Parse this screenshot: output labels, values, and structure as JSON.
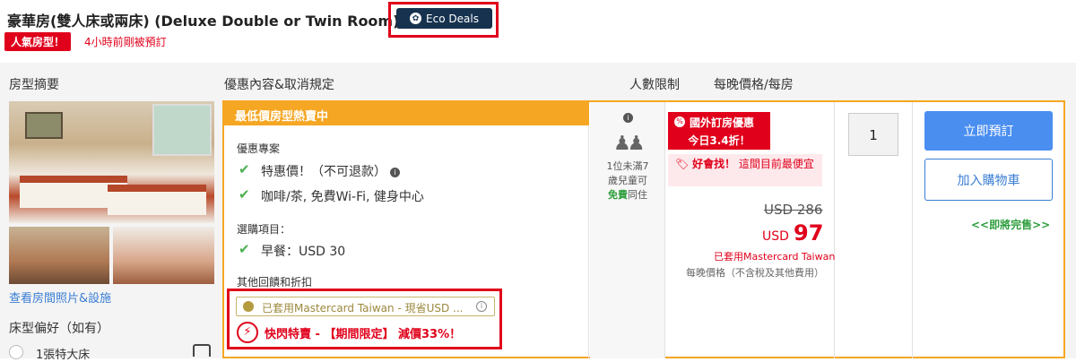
{
  "room": {
    "title": "豪華房(雙人床或兩床) (Deluxe Double or Twin Room)",
    "eco_label": "Eco Deals",
    "popular_label": "人氣房型！",
    "booked_text": "4小時前剛被預訂"
  },
  "columns": {
    "summary": "房型摘要",
    "deal": "優惠內容&取消規定",
    "people": "人數限制",
    "price": "每晚價格/每房"
  },
  "left": {
    "view_photos": "查看房間照片&設施",
    "bed_pref": "床型偏好（如有）",
    "bed_option": "1張特大床"
  },
  "deal": {
    "banner": "最低價房型熱賣中",
    "plan_title": "優惠專案",
    "item1": "特惠價！（不可退款）",
    "item2": "咖啡/茶, 免費Wi-Fi, 健身中心",
    "options_title": "選購項目：",
    "item3": "早餐：USD 30",
    "other_title": "其他回饋和折扣",
    "mc_text": "已套用Mastercard Taiwan - 現省USD ...",
    "flash_text": "快閃特賣 - 【期間限定】 減價33%！"
  },
  "people": {
    "line1": "1位未滿7",
    "line2": "歲兒童可",
    "free": "免費",
    "stay": "同住"
  },
  "price": {
    "intl_label": "國外訂房優惠",
    "discount_label": "今日3.4折！",
    "best_prefix": "好會找！",
    "best_text": "這間目前最便宜",
    "old_price": "USD 286",
    "currency": "USD",
    "new_price": "97",
    "mc_applied": "已套用Mastercard Taiwan",
    "per_night": "每晚價格（不含稅及其他費用）"
  },
  "quantity": {
    "value": "1"
  },
  "actions": {
    "book": "立即預訂",
    "cart": "加入購物車",
    "soldout": "<<即將完售>>"
  },
  "colors": {
    "accent_orange": "#f5a623",
    "red": "#e0001b",
    "blue": "#4a8ef0",
    "navy": "#16324f",
    "green": "#2e9e3e"
  },
  "icons": [
    "leaf-icon",
    "check-icon",
    "info-icon",
    "mastercard-icon",
    "flash-icon",
    "people-icon",
    "tag-icon",
    "bed-icon"
  ]
}
